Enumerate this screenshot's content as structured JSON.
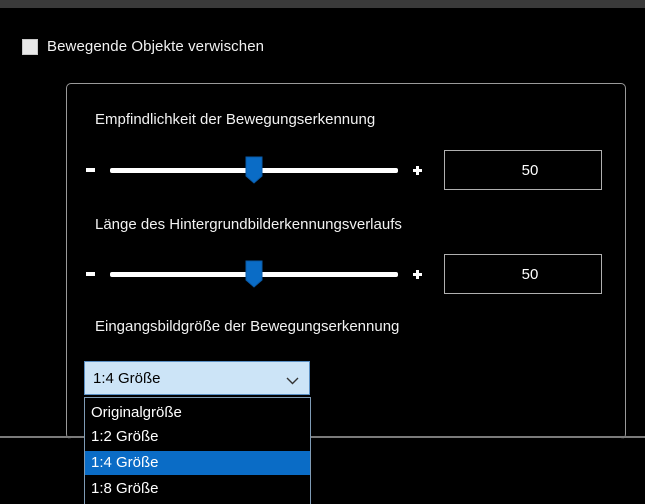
{
  "blur_checkbox": {
    "label": "Bewegende Objekte verwischen",
    "checked": false
  },
  "sensitivity": {
    "label": "Empfindlichkeit der Bewegungserkennung",
    "minus": "-",
    "plus": "+",
    "value": "50",
    "level": 50
  },
  "history": {
    "label": "Länge des Hintergrundbilderkennungsverlaufs",
    "minus": "-",
    "plus": "+",
    "value": "50",
    "level": 50
  },
  "input_size": {
    "label": "Eingangsbildgröße der Bewegungserkennung",
    "selected": "1:4 Größe",
    "options": [
      "Originalgröße",
      "1:2 Größe",
      "1:4 Größe",
      "1:8 Größe"
    ],
    "highlighted": "1:4 Größe"
  },
  "colors": {
    "background": "#000000",
    "selection": "#0a6cc6",
    "combo_bg": "#cce4f7",
    "thumb": "#0a6cc6"
  },
  "icons": {
    "chevron": "chevron-down-icon",
    "thumb": "slider-thumb-icon"
  }
}
